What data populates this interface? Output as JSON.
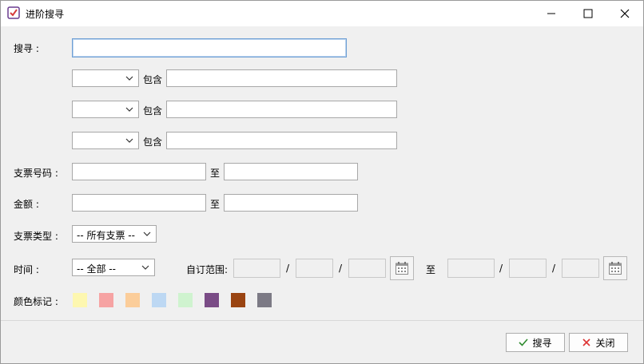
{
  "window": {
    "title": "进阶搜寻"
  },
  "labels": {
    "search": "搜寻 :",
    "contains": "包含",
    "cheque_no": "支票号码 :",
    "to": "至",
    "amount": "金额 :",
    "cheque_type": "支票类型 :",
    "time": "时间 :",
    "custom_range": "自订范围:",
    "slash": "/",
    "color_tag": "颜色标记 :"
  },
  "inputs": {
    "search_value": "",
    "contains_1": "",
    "contains_2": "",
    "contains_3": "",
    "cheque_from": "",
    "cheque_to": "",
    "amount_from": "",
    "amount_to": ""
  },
  "selects": {
    "field_1": "",
    "field_2": "",
    "field_3": "",
    "cheque_type": "-- 所有支票 --",
    "time": "-- 全部  --"
  },
  "swatches": [
    "#fdf7b0",
    "#f6a3a3",
    "#fbcd9a",
    "#bdd8f3",
    "#cff3cf",
    "#7a4c86",
    "#9a4411",
    "#7c7a85"
  ],
  "buttons": {
    "search": "搜寻",
    "close": "关闭"
  },
  "colors": {
    "ok_check": "#2e8b2e",
    "close_x": "#d33"
  }
}
